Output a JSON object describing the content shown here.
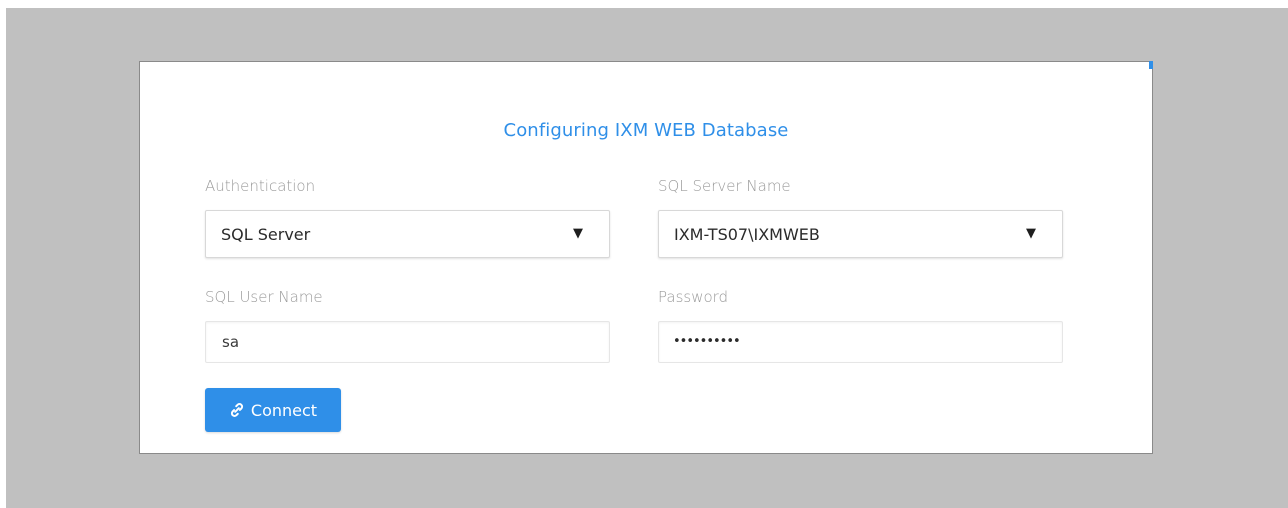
{
  "dialog": {
    "title": "Configuring IXM WEB Database"
  },
  "fields": {
    "authentication": {
      "label": "Authentication",
      "value": "SQL Server"
    },
    "sql_server_name": {
      "label": "SQL Server Name",
      "value": "IXM-TS07\\IXMWEB"
    },
    "sql_user_name": {
      "label": "SQL User Name",
      "value": "sa"
    },
    "password": {
      "label": "Password",
      "value": "••••••••••"
    }
  },
  "actions": {
    "connect_label": "Connect"
  },
  "icons": {
    "dropdown": "caret-down-icon",
    "connect": "link-icon"
  },
  "colors": {
    "accent": "#2f8fe8",
    "backdrop": "#c0c0c0",
    "label": "#9a9a9a"
  }
}
